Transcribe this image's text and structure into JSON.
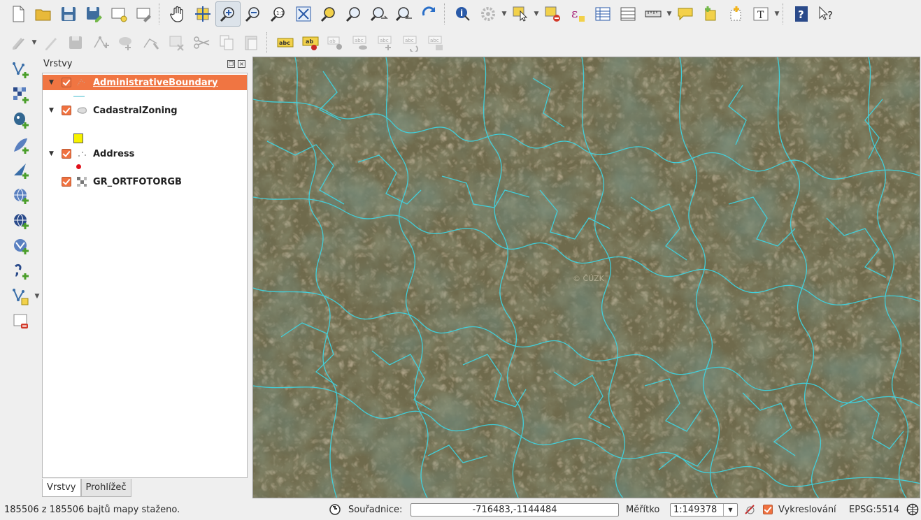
{
  "toolbar": {
    "row1": [
      "new-project",
      "open-project",
      "save-project",
      "save-as",
      "new-print-composer",
      "composer-manager",
      "pan-map",
      "pan-to-selection",
      "zoom-in",
      "zoom-out",
      "zoom-actual-size",
      "zoom-full",
      "zoom-to-selection",
      "zoom-to-layer",
      "zoom-last",
      "zoom-next",
      "refresh",
      "identify",
      "action",
      "select-features",
      "deselect-all",
      "field-calculator",
      "attribute-table",
      "statistics",
      "measure",
      "map-tips",
      "new-bookmark",
      "show-bookmarks",
      "text-annotation",
      "help",
      "whats-this"
    ],
    "row2": [
      "current-edits",
      "toggle-editing",
      "save-edits",
      "add-feature",
      "move-feature",
      "node-tool",
      "delete-selected",
      "cut-features",
      "copy-features",
      "paste-features",
      "label-toolbar",
      "layer-labeling",
      "pin-labels",
      "show-hide-labels",
      "move-label",
      "rotate-label",
      "change-label"
    ]
  },
  "left_toolbar": [
    "add-vector-layer",
    "add-raster-layer",
    "add-postgis-layer",
    "add-spatialite-layer",
    "add-mssql-layer",
    "add-wms-layer",
    "add-wcs-layer",
    "add-wfs-layer",
    "add-delimited-text",
    "new-shapefile",
    "remove-layer"
  ],
  "layers_panel": {
    "title": "Vrstvy",
    "layers": [
      {
        "name": "AdministrativeBoundary",
        "checked": true,
        "expanded": true,
        "selected": true
      },
      {
        "name": "CadastralZoning",
        "checked": true,
        "expanded": true,
        "selected": false
      },
      {
        "name": "Address",
        "checked": true,
        "expanded": true,
        "selected": false
      },
      {
        "name": "GR_ORTFOTORGB",
        "checked": true,
        "expanded": false,
        "selected": false
      }
    ],
    "tabs": [
      "Vrstvy",
      "Prohlížeč"
    ],
    "active_tab": "Vrstvy"
  },
  "map": {
    "watermark": "© ČÚZK",
    "boundary_color": "#3fd3e0"
  },
  "status": {
    "message": "185506 z 185506 bajtů mapy staženo.",
    "coord_label": "Souřadnice:",
    "coord_value": "-716483,-1144484",
    "scale_label": "Měřítko",
    "scale_value": "1:149378",
    "render_label": "Vykreslování",
    "crs": "EPSG:5514"
  }
}
